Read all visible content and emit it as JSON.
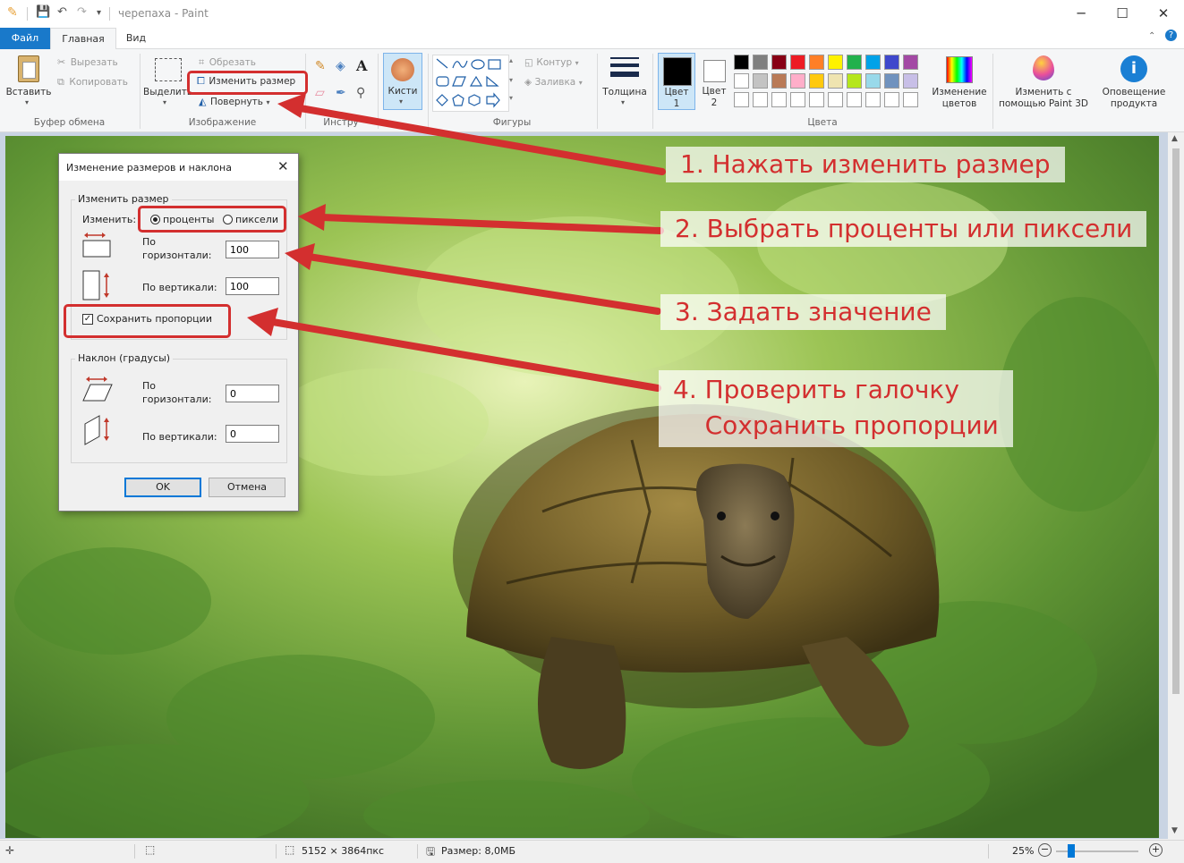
{
  "window": {
    "title": "черепаха - Paint"
  },
  "tabs": {
    "file": "Файл",
    "home": "Главная",
    "view": "Вид"
  },
  "ribbon": {
    "clipboard": {
      "paste": "Вставить",
      "cut": "Вырезать",
      "copy": "Копировать",
      "group": "Буфер обмена"
    },
    "image": {
      "select": "Выделить",
      "crop": "Обрезать",
      "resize": "Изменить размер",
      "rotate": "Повернуть",
      "group": "Изображение"
    },
    "tools": {
      "group": "Инстру"
    },
    "brushes": "Кисти",
    "shapes": {
      "outline": "Контур",
      "fill": "Заливка",
      "group": "Фигуры"
    },
    "size": "Толщина",
    "color1": {
      "line1": "Цвет",
      "line2": "1"
    },
    "color2": {
      "line1": "Цвет",
      "line2": "2"
    },
    "colors_group": "Цвета",
    "edit_colors": {
      "line1": "Изменение",
      "line2": "цветов"
    },
    "paint3d": {
      "line1": "Изменить с",
      "line2": "помощью Paint 3D"
    },
    "alert": {
      "line1": "Оповещение",
      "line2": "продукта"
    },
    "palette_row1": [
      "#000000",
      "#7f7f7f",
      "#880015",
      "#ed1c24",
      "#ff7f27",
      "#fff200",
      "#22b14c",
      "#00a2e8",
      "#3f48cc",
      "#a349a4"
    ],
    "palette_row2": [
      "#ffffff",
      "#c3c3c3",
      "#b97a57",
      "#ffaec9",
      "#ffc90e",
      "#efe4b0",
      "#b5e61d",
      "#99d9ea",
      "#7092be",
      "#c8bfe7"
    ]
  },
  "dialog": {
    "title": "Изменение размеров и наклона",
    "resize_legend": "Изменить размер",
    "by_label": "Изменить:",
    "percent": "проценты",
    "pixels": "пиксели",
    "horizontal_1": "По",
    "horizontal_2": "горизонтали:",
    "vertical": "По вертикали:",
    "resize_h_value": "100",
    "resize_v_value": "100",
    "keep_ratio": "Сохранить пропорции",
    "keep_ratio_checked": true,
    "percent_selected": true,
    "skew_legend": "Наклон (градусы)",
    "skew_h_value": "0",
    "skew_v_value": "0",
    "ok": "OK",
    "cancel": "Отмена"
  },
  "callouts": {
    "step1": "1. Нажать изменить размер",
    "step2": "2. Выбрать проценты или пиксели",
    "step3": "3. Задать значение",
    "step4_line1": "4. Проверить галочку",
    "step4_line2": "    Сохранить пропорции"
  },
  "status": {
    "dimensions": "5152 × 3864пкс",
    "filesize": "Размер: 8,0МБ",
    "zoom": "25%"
  },
  "accent_color": "#d32f2f"
}
